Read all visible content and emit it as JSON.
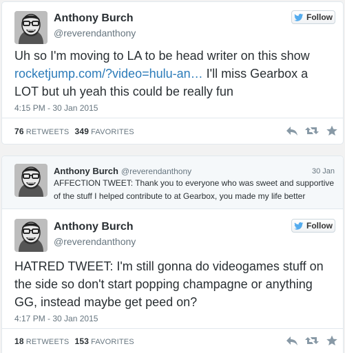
{
  "tweets": [
    {
      "name": "Anthony Burch",
      "handle": "@reverendanthony",
      "follow_label": "Follow",
      "text_before": "Uh so I'm moving to LA to be head writer on this show ",
      "link": "rocketjump.com/?video=hulu-an…",
      "text_after": " I'll miss Gearbox a LOT but uh yeah this could be really fun",
      "timestamp": "4:15 PM - 30 Jan 2015",
      "retweets": "76",
      "retweets_label": "RETWEETS",
      "favorites": "349",
      "favorites_label": "FAVORITES"
    },
    {
      "name": "Anthony Burch",
      "handle": "@reverendanthony",
      "follow_label": "Follow",
      "text": "HATRED TWEET: I'm still gonna do videogames stuff on the side so don't start popping champagne or anything GG, instead maybe get peed on?",
      "timestamp": "4:17 PM - 30 Jan 2015",
      "retweets": "18",
      "retweets_label": "RETWEETS",
      "favorites": "153",
      "favorites_label": "FAVORITES"
    }
  ],
  "in_reply_to": {
    "name": "Anthony Burch",
    "handle": "@reverendanthony",
    "date": "30 Jan",
    "text": "AFFECTION TWEET: Thank you to everyone who was sweet and supportive of the stuff I helped contribute to at Gearbox, you made my life better"
  },
  "icons": {
    "follow": "twitter-bird-icon",
    "reply": "reply-icon",
    "retweet": "retweet-icon",
    "favorite": "star-icon"
  },
  "colors": {
    "link": "#2b7bb9",
    "twitter_blue": "#55acee",
    "action_gray": "#8899a6"
  }
}
